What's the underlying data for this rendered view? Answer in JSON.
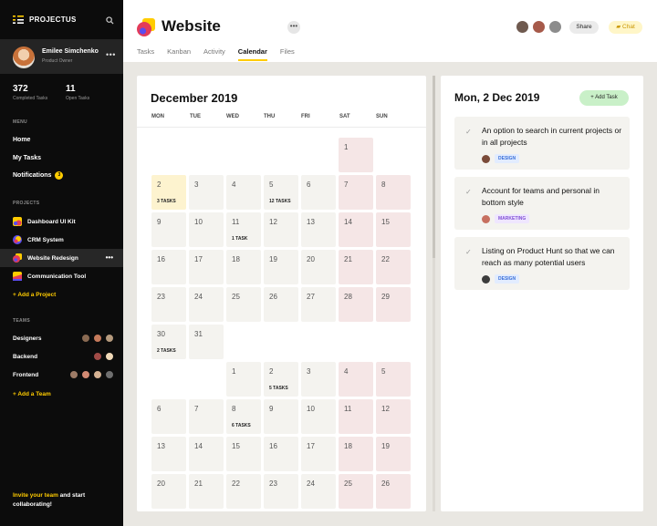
{
  "sidebar": {
    "brand": "PROJECTUS",
    "profile": {
      "name": "Emilee Simchenko",
      "role": "Product Owner"
    },
    "stats": [
      {
        "value": "372",
        "label": "Completed Tasks"
      },
      {
        "value": "11",
        "label": "Open Tasks"
      }
    ],
    "menu_heading": "MENU",
    "menu": [
      {
        "label": "Home"
      },
      {
        "label": "My Tasks"
      },
      {
        "label": "Notifications",
        "badge": "3"
      }
    ],
    "projects_heading": "PROJECTS",
    "projects": [
      {
        "label": "Dashboard UI Kit",
        "icon": "dashboard-kit-icon",
        "active": false
      },
      {
        "label": "CRM System",
        "icon": "crm-icon",
        "active": false
      },
      {
        "label": "Website Redesign",
        "icon": "website-icon",
        "active": true
      },
      {
        "label": "Communication Tool",
        "icon": "communication-icon",
        "active": false
      }
    ],
    "add_project": "+ Add a Project",
    "teams_heading": "TEAMS",
    "teams": [
      {
        "label": "Designers"
      },
      {
        "label": "Backend"
      },
      {
        "label": "Frontend"
      }
    ],
    "add_team": "+ Add a Team",
    "invite_highlight": "Invite your team",
    "invite_rest": " and start collaborating!"
  },
  "header": {
    "title": "Website",
    "tabs": [
      "Tasks",
      "Kanban",
      "Activity",
      "Calendar",
      "Files"
    ],
    "active_tab": "Calendar",
    "share_label": "Share",
    "chat_label": "Chat"
  },
  "calendar": {
    "month_title": "December 2019",
    "weekdays": [
      "MON",
      "TUE",
      "WED",
      "THU",
      "FRI",
      "SAT",
      "SUN"
    ],
    "weeks": [
      [
        null,
        null,
        null,
        null,
        null,
        {
          "d": "1",
          "w": true
        },
        null
      ],
      [
        {
          "d": "2",
          "today": true,
          "t": "3 TASKS"
        },
        {
          "d": "3"
        },
        {
          "d": "4"
        },
        {
          "d": "5",
          "t": "12 TASKS"
        },
        {
          "d": "6"
        },
        {
          "d": "7",
          "w": true
        },
        {
          "d": "8",
          "w": true
        }
      ],
      [
        {
          "d": "9"
        },
        {
          "d": "10"
        },
        {
          "d": "11",
          "t": "1 TASK"
        },
        {
          "d": "12"
        },
        {
          "d": "13"
        },
        {
          "d": "14",
          "w": true
        },
        {
          "d": "15",
          "w": true
        }
      ],
      [
        {
          "d": "16"
        },
        {
          "d": "17"
        },
        {
          "d": "18"
        },
        {
          "d": "19"
        },
        {
          "d": "20"
        },
        {
          "d": "21",
          "w": true
        },
        {
          "d": "22",
          "w": true
        }
      ],
      [
        {
          "d": "23"
        },
        {
          "d": "24"
        },
        {
          "d": "25"
        },
        {
          "d": "26"
        },
        {
          "d": "27"
        },
        {
          "d": "28",
          "w": true
        },
        {
          "d": "29",
          "w": true
        }
      ],
      [
        {
          "d": "30",
          "t": "2 TASKS"
        },
        {
          "d": "31"
        },
        null,
        null,
        null,
        null,
        null
      ],
      [
        null,
        null,
        {
          "d": "1"
        },
        {
          "d": "2",
          "t": "5 TASKS"
        },
        {
          "d": "3"
        },
        {
          "d": "4",
          "w": true
        },
        {
          "d": "5",
          "w": true
        }
      ],
      [
        {
          "d": "6"
        },
        {
          "d": "7"
        },
        {
          "d": "8",
          "t": "6 TASKS"
        },
        {
          "d": "9"
        },
        {
          "d": "10"
        },
        {
          "d": "11",
          "w": true
        },
        {
          "d": "12",
          "w": true
        }
      ],
      [
        {
          "d": "13"
        },
        {
          "d": "14"
        },
        {
          "d": "15"
        },
        {
          "d": "16"
        },
        {
          "d": "17"
        },
        {
          "d": "18",
          "w": true
        },
        {
          "d": "19",
          "w": true
        }
      ],
      [
        {
          "d": "20"
        },
        {
          "d": "21"
        },
        {
          "d": "22"
        },
        {
          "d": "23"
        },
        {
          "d": "24"
        },
        {
          "d": "25",
          "w": true
        },
        {
          "d": "26",
          "w": true
        }
      ]
    ]
  },
  "detail": {
    "date_title": "Mon, 2 Dec 2019",
    "add_task_label": "+ Add Task",
    "tasks": [
      {
        "text": "An option to search in current projects or in all projects",
        "tag": "DESIGN"
      },
      {
        "text": "Account for teams and personal in bottom style",
        "tag": "MARKETING"
      },
      {
        "text": "Listing on Product Hunt so that we can reach as many potential users",
        "tag": "DESIGN"
      }
    ]
  },
  "colors": {
    "accent": "#ffcc00",
    "sidebar_bg": "#0c0c0c",
    "weekend": "#f5e6e6",
    "today": "#fdf3cf",
    "add_task": "#c9f0c8"
  }
}
